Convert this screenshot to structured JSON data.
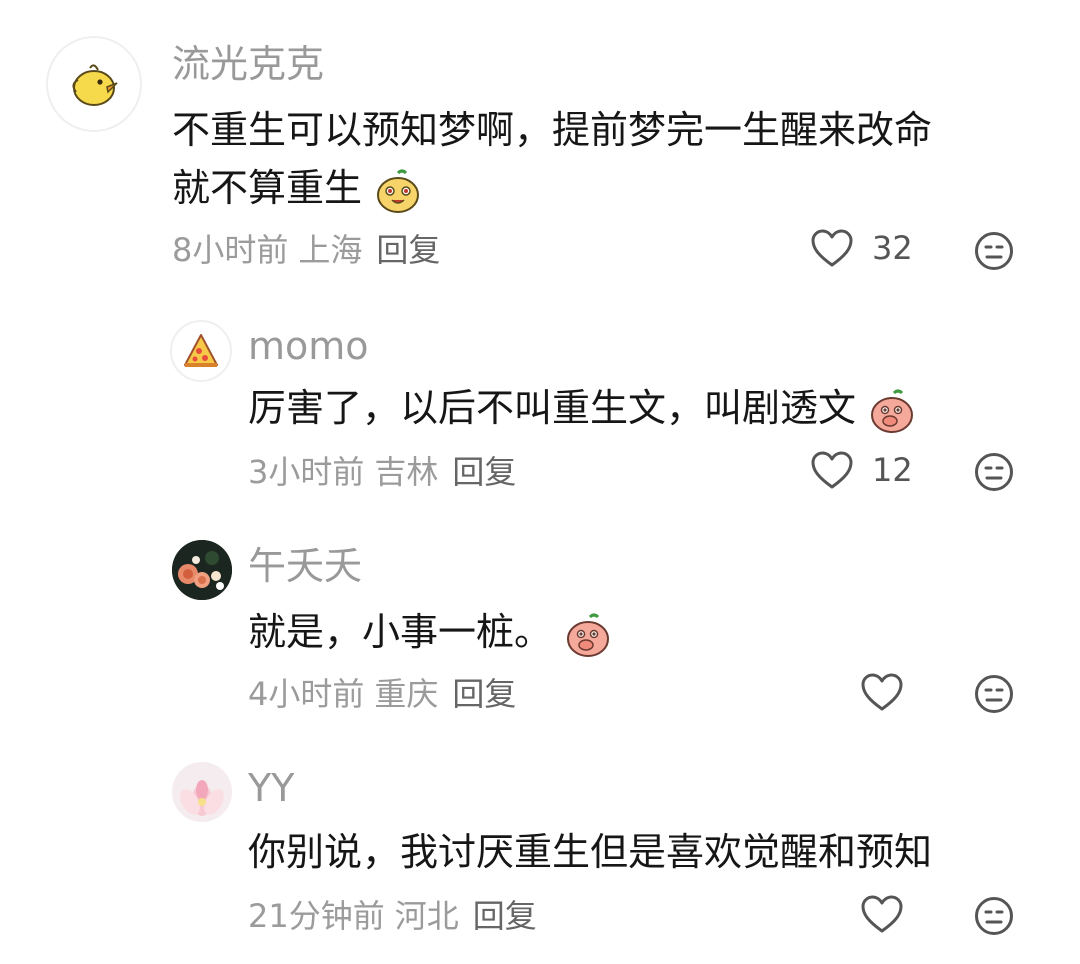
{
  "comments": [
    {
      "author": "流光克克",
      "text_lines": [
        "不重生可以预知梦啊，提前梦完一生醒来改命",
        "就不算重生"
      ],
      "time": "8小时前",
      "location": "上海",
      "reply_label": "回复",
      "likes": "32",
      "avatar_icon": "chick-icon"
    },
    {
      "author": "momo",
      "text_lines": [
        "厉害了，以后不叫重生文，叫剧透文"
      ],
      "time": "3小时前",
      "location": "吉林",
      "reply_label": "回复",
      "likes": "12",
      "avatar_icon": "pizza-icon"
    },
    {
      "author": "午夭夭",
      "text_lines": [
        "就是，小事一桩。"
      ],
      "time": "4小时前",
      "location": "重庆",
      "reply_label": "回复",
      "likes": "",
      "avatar_icon": "roses-photo"
    },
    {
      "author": "YY",
      "text_lines": [
        "你别说，我讨厌重生但是喜欢觉醒和预知"
      ],
      "time": "21分钟前",
      "location": "河北",
      "reply_label": "回复",
      "likes": "",
      "avatar_icon": "lotus-photo"
    }
  ],
  "colors": {
    "author": "#999999",
    "text": "#161616",
    "meta": "#9b9b9b",
    "icon": "#555555"
  }
}
